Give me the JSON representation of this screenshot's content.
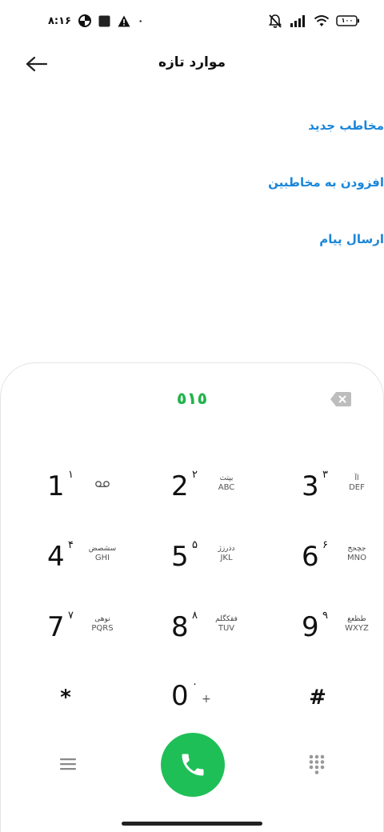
{
  "status_bar": {
    "time": "۸:۱۶",
    "notification_dot": "۰",
    "battery_level": "۱۰۰",
    "icons": [
      "data-saver-icon",
      "square-icon",
      "warning-icon",
      "muted-bell-icon",
      "signal-icon",
      "wifi-icon",
      "battery-icon"
    ]
  },
  "header": {
    "title": "موارد تازه",
    "back_icon": "arrow-left-icon"
  },
  "actions": [
    {
      "label": "مخاطب جدید"
    },
    {
      "label": "افزودن به مخاطبین"
    },
    {
      "label": "ارسال پیام"
    }
  ],
  "dialpad": {
    "number": "٥١٥",
    "keys": [
      {
        "digit": "1",
        "sup": "١",
        "fa": "",
        "en": ""
      },
      {
        "digit": "2",
        "sup": "٢",
        "fa": "بپتث",
        "en": "ABC"
      },
      {
        "digit": "3",
        "sup": "٣",
        "fa": "اآ",
        "en": "DEF"
      },
      {
        "digit": "4",
        "sup": "۴",
        "fa": "سشصض",
        "en": "GHI"
      },
      {
        "digit": "5",
        "sup": "۵",
        "fa": "دذرزژ",
        "en": "JKL"
      },
      {
        "digit": "6",
        "sup": "۶",
        "fa": "جچحخ",
        "en": "MNO"
      },
      {
        "digit": "7",
        "sup": "٧",
        "fa": "نوهی",
        "en": "PQRS"
      },
      {
        "digit": "8",
        "sup": "٨",
        "fa": "فقکگلم",
        "en": "TUV"
      },
      {
        "digit": "9",
        "sup": "٩",
        "fa": "طظعغ",
        "en": "WXYZ"
      },
      {
        "digit": "*",
        "sup": "",
        "fa": "",
        "en": ""
      },
      {
        "digit": "0",
        "sup": "٠",
        "fa": "",
        "en": "+"
      },
      {
        "digit": "#",
        "sup": "",
        "fa": "",
        "en": ""
      }
    ]
  },
  "colors": {
    "accent_link": "#1a86d9",
    "call_green": "#1fbf58",
    "number_green": "#22b34c"
  }
}
